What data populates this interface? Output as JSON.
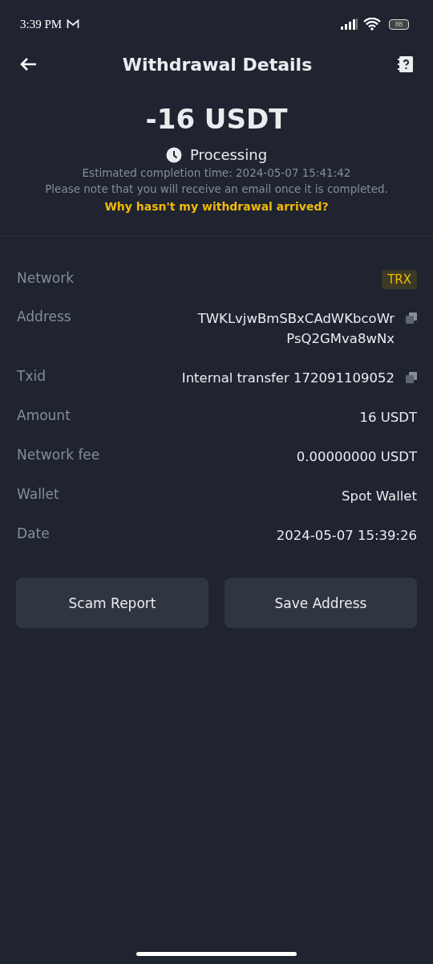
{
  "status_bar": {
    "time": "3:39 PM",
    "battery": "88"
  },
  "header": {
    "title": "Withdrawal Details"
  },
  "summary": {
    "amount": "-16 USDT",
    "status": "Processing",
    "estimate": "Estimated completion time: 2024-05-07 15:41:42",
    "note": "Please note that you will receive an email once it is completed.",
    "help_link": "Why hasn't my withdrawal arrived?"
  },
  "details": [
    {
      "kind": "tag",
      "label": "Network",
      "value": [
        "TRX"
      ]
    },
    {
      "kind": "copy",
      "label": "Address",
      "value": [
        "TWKLvjwBmSBxCAdWKbcoWr",
        "PsQ2GMva8wNx"
      ]
    },
    {
      "kind": "copy",
      "label": "Txid",
      "value": [
        "Internal transfer 172091109052"
      ]
    },
    {
      "kind": "plain",
      "label": "Amount",
      "value": [
        "16 USDT"
      ]
    },
    {
      "kind": "plain",
      "label": "Network fee",
      "value": [
        "0.00000000 USDT"
      ]
    },
    {
      "kind": "plain",
      "label": "Wallet",
      "value": [
        "Spot Wallet"
      ]
    },
    {
      "kind": "plain",
      "label": "Date",
      "value": [
        "2024-05-07 15:39:26"
      ]
    }
  ],
  "buttons": [
    "Scam Report",
    "Save Address"
  ]
}
